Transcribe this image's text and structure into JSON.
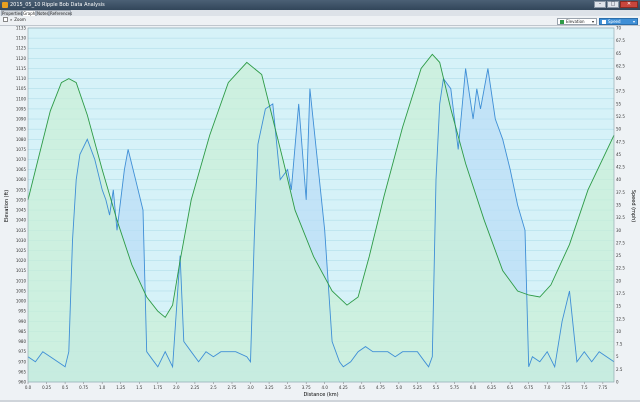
{
  "window": {
    "title": "2015_05_10 Ripple Bob Data Analysis",
    "minimize_glyph": "–",
    "maximize_glyph": "□",
    "close_glyph": "✕"
  },
  "tabs": [
    {
      "label": "Properties",
      "active": false
    },
    {
      "label": "Graph",
      "active": true
    },
    {
      "label": "Notes",
      "active": false
    },
    {
      "label": "References",
      "active": false
    }
  ],
  "toolbar": {
    "zoom_label": "Zoom",
    "series_selects": [
      {
        "label": "Elevation",
        "color": "#2e9b47"
      },
      {
        "label": "Speed",
        "color": "#3f8fd6"
      }
    ]
  },
  "colors": {
    "elevation": "#2e9b47",
    "elevation_fill": "#c9f0d6",
    "speed": "#3f8fd6",
    "speed_fill": "#b9ddf6",
    "plot_bg": "#d6f2f8"
  },
  "chart_data": {
    "type": "line",
    "xlabel": "Distance (km)",
    "ylabel_left": "Elevation (ft)",
    "ylabel_right": "Speed (mph)",
    "xlim": [
      0,
      7.9
    ],
    "ylim_left": [
      960,
      1135
    ],
    "ylim_right": [
      0,
      70
    ],
    "x_ticks": [
      "0.0",
      "0.25",
      "0.5",
      "0.75",
      "1.0",
      "1.25",
      "1.5",
      "1.75",
      "2.0",
      "2.25",
      "2.5",
      "2.75",
      "3.0",
      "3.25",
      "3.5",
      "3.75",
      "4.0",
      "4.25",
      "4.5",
      "4.75",
      "5.0",
      "5.25",
      "5.5",
      "5.75",
      "6.0",
      "6.25",
      "6.5",
      "6.75",
      "7.0",
      "7.25",
      "7.5",
      "7.75"
    ],
    "y_left_ticks": [
      "960",
      "965",
      "970",
      "975",
      "980",
      "985",
      "990",
      "995",
      "1000",
      "1005",
      "1010",
      "1015",
      "1020",
      "1025",
      "1030",
      "1035",
      "1040",
      "1045",
      "1050",
      "1055",
      "1060",
      "1065",
      "1070",
      "1075",
      "1080",
      "1085",
      "1090",
      "1095",
      "1100",
      "1105",
      "1110",
      "1115",
      "1120",
      "1125",
      "1130",
      "1135"
    ],
    "y_right_ticks": [
      "0",
      "2.5",
      "5",
      "7.5",
      "10",
      "12.5",
      "15",
      "17.5",
      "20",
      "22.5",
      "25",
      "27.5",
      "30",
      "32.5",
      "35",
      "37.5",
      "40",
      "42.5",
      "45",
      "47.5",
      "50",
      "52.5",
      "55",
      "57.5",
      "60",
      "62.5",
      "65",
      "67.5",
      "70"
    ],
    "grid": true,
    "series": [
      {
        "name": "Elevation",
        "axis": "left",
        "x": [
          0.0,
          0.15,
          0.3,
          0.45,
          0.55,
          0.65,
          0.8,
          1.0,
          1.2,
          1.4,
          1.6,
          1.75,
          1.85,
          1.95,
          2.05,
          2.2,
          2.45,
          2.7,
          2.95,
          3.15,
          3.3,
          3.45,
          3.6,
          3.85,
          4.1,
          4.3,
          4.45,
          4.6,
          4.8,
          5.05,
          5.3,
          5.45,
          5.55,
          5.7,
          5.9,
          6.15,
          6.4,
          6.6,
          6.75,
          6.9,
          7.05,
          7.3,
          7.55,
          7.9
        ],
        "y": [
          1050,
          1072,
          1094,
          1108,
          1110,
          1108,
          1092,
          1065,
          1040,
          1018,
          1002,
          995,
          992,
          998,
          1020,
          1050,
          1082,
          1108,
          1118,
          1112,
          1090,
          1068,
          1045,
          1022,
          1005,
          998,
          1002,
          1022,
          1052,
          1086,
          1115,
          1122,
          1118,
          1095,
          1068,
          1040,
          1015,
          1005,
          1003,
          1002,
          1008,
          1028,
          1055,
          1082
        ]
      },
      {
        "name": "Speed",
        "axis": "right",
        "x": [
          0.0,
          0.1,
          0.2,
          0.3,
          0.4,
          0.5,
          0.55,
          0.6,
          0.65,
          0.7,
          0.8,
          0.9,
          1.0,
          1.05,
          1.1,
          1.15,
          1.2,
          1.3,
          1.35,
          1.45,
          1.55,
          1.6,
          1.7,
          1.75,
          1.85,
          1.95,
          2.05,
          2.1,
          2.2,
          2.3,
          2.4,
          2.5,
          2.6,
          2.7,
          2.8,
          2.95,
          3.0,
          3.05,
          3.1,
          3.2,
          3.3,
          3.4,
          3.5,
          3.55,
          3.65,
          3.75,
          3.8,
          3.9,
          4.0,
          4.1,
          4.2,
          4.25,
          4.35,
          4.45,
          4.55,
          4.65,
          4.75,
          4.85,
          4.95,
          5.05,
          5.15,
          5.25,
          5.35,
          5.4,
          5.45,
          5.5,
          5.55,
          5.6,
          5.7,
          5.8,
          5.9,
          6.0,
          6.05,
          6.1,
          6.2,
          6.3,
          6.4,
          6.5,
          6.6,
          6.7,
          6.75,
          6.8,
          6.9,
          7.0,
          7.1,
          7.2,
          7.3,
          7.4,
          7.5,
          7.6,
          7.7,
          7.9
        ],
        "y": [
          5,
          4,
          6,
          5,
          4,
          3,
          6,
          28,
          40,
          45,
          48,
          44,
          38,
          36,
          33,
          38,
          30,
          42,
          46,
          40,
          34,
          6,
          4,
          3,
          6,
          3,
          25,
          8,
          6,
          4,
          6,
          5,
          6,
          6,
          6,
          5,
          4,
          28,
          47,
          54,
          55,
          40,
          42,
          38,
          55,
          36,
          58,
          44,
          30,
          8,
          4,
          3,
          4,
          6,
          7,
          6,
          6,
          6,
          5,
          6,
          6,
          6,
          4,
          3,
          5,
          40,
          55,
          60,
          58,
          46,
          62,
          52,
          58,
          54,
          62,
          52,
          48,
          42,
          35,
          30,
          3,
          5,
          4,
          6,
          3,
          12,
          18,
          4,
          6,
          4,
          6,
          4
        ]
      }
    ]
  }
}
